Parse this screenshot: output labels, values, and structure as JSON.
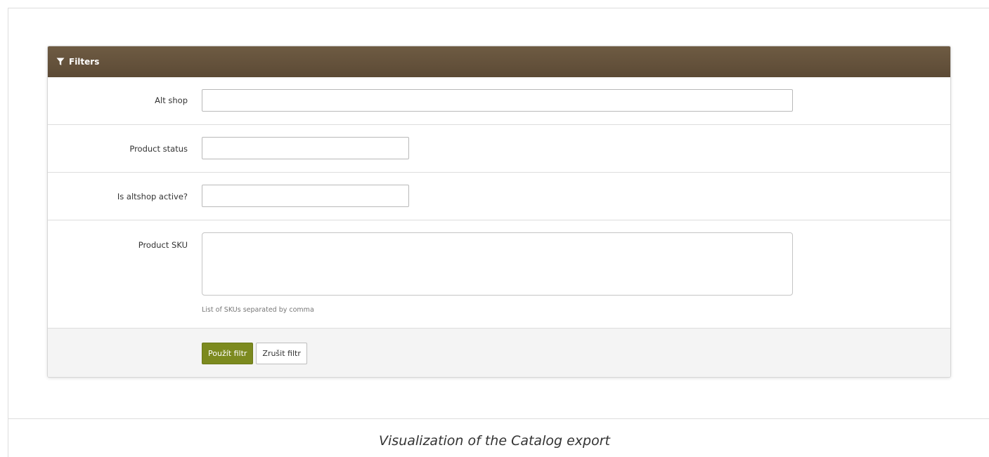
{
  "panel": {
    "title": "Filters",
    "icon": "filter-icon"
  },
  "fields": {
    "alt_shop": {
      "label": "Alt shop",
      "value": ""
    },
    "product_status": {
      "label": "Product status",
      "value": ""
    },
    "altshop_active": {
      "label": "Is altshop active?",
      "value": ""
    },
    "product_sku": {
      "label": "Product SKU",
      "value": "",
      "hint": "List of SKUs separated by comma"
    }
  },
  "buttons": {
    "apply": "Použít filtr",
    "cancel": "Zrušit filtr"
  },
  "colors": {
    "header_bg": "#6a5740",
    "primary_button": "#7c8a1f"
  },
  "caption": "Visualization of the Catalog export"
}
